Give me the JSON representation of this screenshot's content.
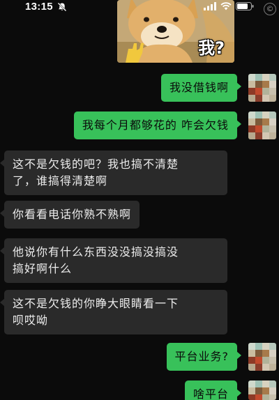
{
  "status_bar": {
    "time": "13:15",
    "bell_icon": "bell-muted-icon",
    "icons": [
      "signal-icon",
      "wifi-icon",
      "battery-icon"
    ],
    "badge": "©"
  },
  "sticker": {
    "description_icon": "shiba-dog-sticker",
    "caption": "我?"
  },
  "messages": [
    {
      "direction": "out",
      "text": "我没借钱啊"
    },
    {
      "direction": "out",
      "text": "我每个月都够花的 咋会欠钱"
    },
    {
      "direction": "in",
      "line1": "这不是欠钱的吧？我也搞不清楚",
      "line2": "了，谁搞得清楚啊"
    },
    {
      "direction": "in",
      "text": "你看看电话你熟不熟啊"
    },
    {
      "direction": "in",
      "line1": "他说你有什么东西没没搞没搞没",
      "line2": "搞好啊什么"
    },
    {
      "direction": "in",
      "line1": "这不是欠钱的你睁大眼睛看一下",
      "line2": "呗哎呦"
    },
    {
      "direction": "out",
      "text": "平台业务?"
    },
    {
      "direction": "out",
      "text": "啥平台"
    }
  ],
  "colors": {
    "background": "#0b0b0b",
    "outgoing_bubble": "#38c15a",
    "incoming_bubble": "#2a2a2a"
  }
}
